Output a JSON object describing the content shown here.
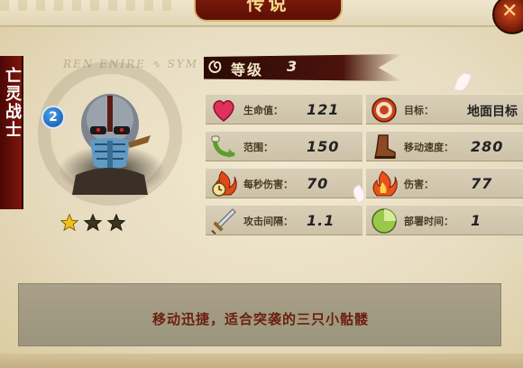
{
  "title": "传说",
  "close_symbol": "✕",
  "unit": {
    "name": "亡灵战士",
    "level_badge": "2",
    "stars": [
      true,
      false,
      false
    ]
  },
  "grade": {
    "label": "等级",
    "value": "3"
  },
  "stats": [
    {
      "id": "hp",
      "label": "生命值：",
      "value": "121",
      "icon": "heart-icon"
    },
    {
      "id": "target",
      "label": "目标：",
      "value": "地面目标",
      "icon": "target-icon"
    },
    {
      "id": "range",
      "label": "范围：",
      "value": "150",
      "icon": "arrow-range-icon"
    },
    {
      "id": "speed",
      "label": "移动速度：",
      "value": "280",
      "icon": "boot-icon"
    },
    {
      "id": "dps",
      "label": "每秒伤害：",
      "value": "70",
      "icon": "flame-clock-icon"
    },
    {
      "id": "damage",
      "label": "伤害：",
      "value": "77",
      "icon": "flame-icon"
    },
    {
      "id": "interval",
      "label": "攻击间隔：",
      "value": "1.1",
      "icon": "sword-icon"
    },
    {
      "id": "deploy",
      "label": "部署时间：",
      "value": "1",
      "icon": "deploy-icon"
    }
  ],
  "description": "移动迅捷，适合突袭的三只小骷髅",
  "rune_text": "REN ENIRE ∿ SYM"
}
